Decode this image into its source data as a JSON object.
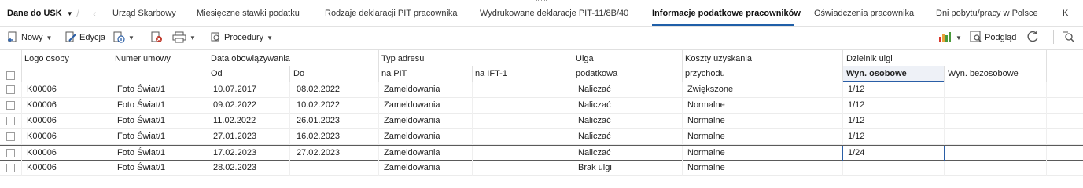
{
  "tabs": {
    "menu_label": "Dane do USK",
    "items": [
      "Urząd Skarbowy",
      "Miesięczne stawki podatku",
      "Rodzaje deklaracji PIT pracownika",
      "Wydrukowane deklaracje PIT-11/8B/40",
      "Informacje podatkowe pracowników",
      "Oświadczenia pracownika",
      "Dni pobytu/pracy w Polsce",
      "K"
    ],
    "active_index": 4
  },
  "toolbar": {
    "new_label": "Nowy",
    "edit_label": "Edycja",
    "procedures_label": "Procedury",
    "preview_label": "Podgląd"
  },
  "columns": {
    "logo": "Logo osoby",
    "contract": "Numer umowy",
    "validity": "Data obowiązywania",
    "validity_from": "Od",
    "validity_to": "Do",
    "address_type": "Typ adresu",
    "address_pit": "na PIT",
    "address_ift": "na IFT-1",
    "relief": "Ulga",
    "relief_sub": "podatkowa",
    "costs": "Koszty uzyskania",
    "costs_sub": "przychodu",
    "divider": "Dzielnik ulgi",
    "divider_personal": "Wyn. osobowe",
    "divider_nonpersonal": "Wyn. bezosobowe"
  },
  "rows": [
    {
      "logo": "K00006",
      "contract": "Foto Świat/1",
      "from": "10.07.2017",
      "to": "08.02.2022",
      "pit": "Zameldowania",
      "ift": "",
      "relief": "Naliczać",
      "costs": "Zwiększone",
      "personal": "1/12",
      "nonpersonal": ""
    },
    {
      "logo": "K00006",
      "contract": "Foto Świat/1",
      "from": "09.02.2022",
      "to": "10.02.2022",
      "pit": "Zameldowania",
      "ift": "",
      "relief": "Naliczać",
      "costs": "Normalne",
      "personal": "1/12",
      "nonpersonal": ""
    },
    {
      "logo": "K00006",
      "contract": "Foto Świat/1",
      "from": "11.02.2022",
      "to": "26.01.2023",
      "pit": "Zameldowania",
      "ift": "",
      "relief": "Naliczać",
      "costs": "Normalne",
      "personal": "1/12",
      "nonpersonal": ""
    },
    {
      "logo": "K00006",
      "contract": "Foto Świat/1",
      "from": "27.01.2023",
      "to": "16.02.2023",
      "pit": "Zameldowania",
      "ift": "",
      "relief": "Naliczać",
      "costs": "Normalne",
      "personal": "1/12",
      "nonpersonal": ""
    },
    {
      "logo": "K00006",
      "contract": "Foto Świat/1",
      "from": "17.02.2023",
      "to": "27.02.2023",
      "pit": "Zameldowania",
      "ift": "",
      "relief": "Naliczać",
      "costs": "Normalne",
      "personal": "1/24",
      "nonpersonal": ""
    },
    {
      "logo": "K00006",
      "contract": "Foto Świat/1",
      "from": "28.02.2023",
      "to": "",
      "pit": "Zameldowania",
      "ift": "",
      "relief": "Brak ulgi",
      "costs": "Normalne",
      "personal": "",
      "nonpersonal": ""
    }
  ],
  "selected_row": 4,
  "colors": {
    "accent": "#1f5fa8",
    "focus": "#2a5ea6",
    "chart_red": "#d9362b",
    "chart_orange": "#e8a23a",
    "chart_green": "#4a9a3c",
    "delete_red": "#c0392b"
  },
  "icons": [
    "chevron-down-icon",
    "chevron-left-icon",
    "new-document-icon",
    "edit-icon",
    "info-icon",
    "delete-icon",
    "print-icon",
    "procedures-icon",
    "chart-icon",
    "preview-icon",
    "refresh-icon",
    "search-icon"
  ]
}
